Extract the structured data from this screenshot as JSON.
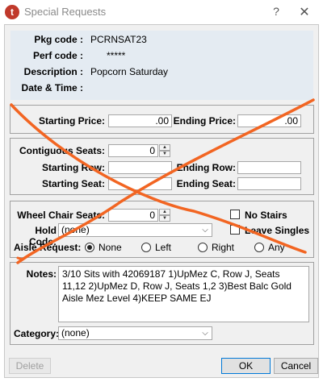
{
  "window": {
    "app_icon": "t",
    "title": "Special Requests",
    "help_label": "?",
    "close_label": "✕"
  },
  "header": {
    "pkg_code_label": "Pkg code :",
    "pkg_code_value": "PCRNSAT23",
    "perf_code_label": "Perf code :",
    "perf_code_value": "*****",
    "description_label": "Description :",
    "description_value": "Popcorn Saturday",
    "datetime_label": "Date & Time :",
    "datetime_value": ""
  },
  "price": {
    "starting_label": "Starting Price:",
    "starting_value": ".00",
    "ending_label": "Ending Price:",
    "ending_value": ".00"
  },
  "seats": {
    "contiguous_label": "Contiguous Seats:",
    "contiguous_value": "0",
    "starting_row_label": "Starting Row:",
    "starting_row_value": "",
    "ending_row_label": "Ending Row:",
    "ending_row_value": "",
    "starting_seat_label": "Starting Seat:",
    "starting_seat_value": "",
    "ending_seat_label": "Ending Seat:",
    "ending_seat_value": ""
  },
  "options": {
    "wheelchair_label": "Wheel Chair Seats:",
    "wheelchair_value": "0",
    "no_stairs_label": "No Stairs",
    "no_stairs_checked": false,
    "hold_code_label": "Hold Code:",
    "hold_code_value": "(none)",
    "leave_singles_label": "Leave Singles",
    "leave_singles_checked": false,
    "aisle_label": "Aisle Request:",
    "aisle_options": [
      "None",
      "Left",
      "Right",
      "Any"
    ],
    "aisle_selected": "None"
  },
  "notes": {
    "label": "Notes:",
    "value": "3/10 Sits with 42069187 1)UpMez C, Row J, Seats 11,12 2)UpMez D, Row J, Seats 1,2 3)Best Balc Gold Aisle Mez Level 4)KEEP SAME EJ"
  },
  "category": {
    "label": "Category:",
    "value": "(none)"
  },
  "buttons": {
    "delete": "Delete",
    "ok": "OK",
    "cancel": "Cancel"
  },
  "colors": {
    "annotation": "#f26522",
    "header_panel": "#e4ebf2",
    "app_icon": "#c0392b"
  }
}
